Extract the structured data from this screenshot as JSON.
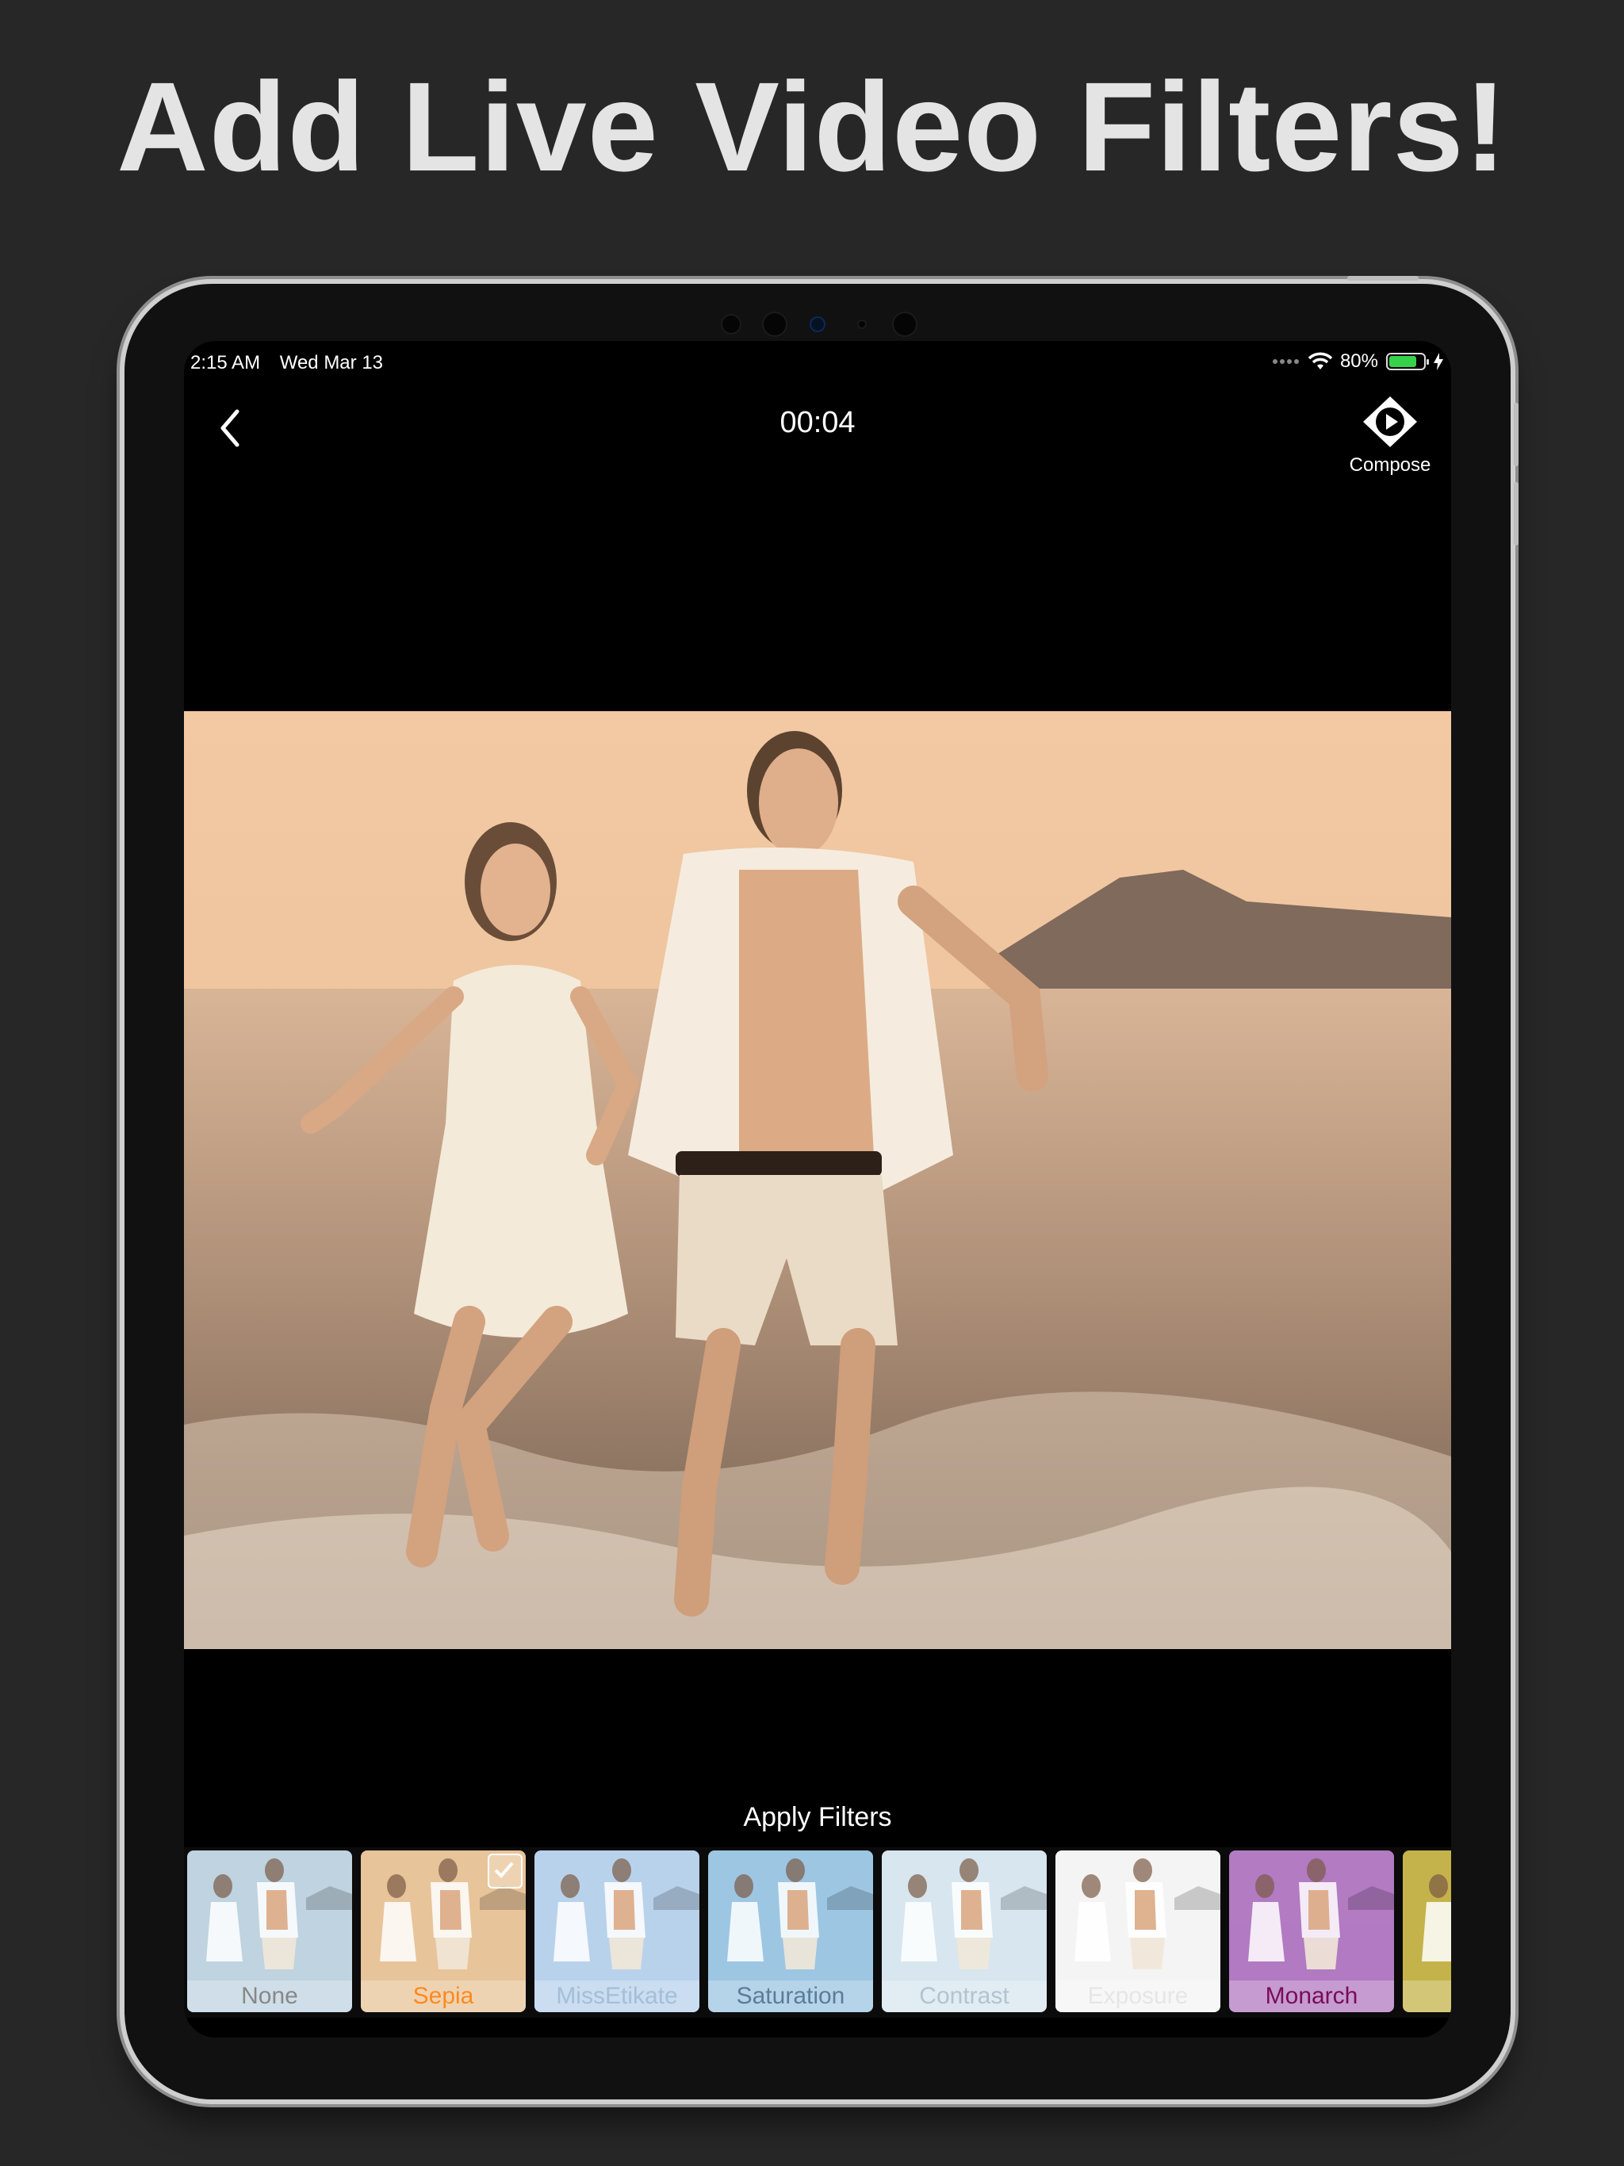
{
  "headline": "Add Live Video Filters!",
  "status_bar": {
    "time": "2:15 AM",
    "date": "Wed Mar 13",
    "battery": "80%",
    "battery_level": 0.8
  },
  "nav": {
    "timer": "00:04",
    "compose_label": "Compose"
  },
  "apply_filters_label": "Apply Filters",
  "filters": [
    {
      "name": "None",
      "tint": "#bfd3e0",
      "label_color": "#888888",
      "selected": false
    },
    {
      "name": "Sepia",
      "tint": "#e8c49a",
      "label_color": "#ff8a1c",
      "selected": true
    },
    {
      "name": "MissEtikate",
      "tint": "#b9d2ec",
      "label_color": "#a4bfd6",
      "selected": false
    },
    {
      "name": "Saturation",
      "tint": "#9dc6e3",
      "label_color": "#5b7d98",
      "selected": false
    },
    {
      "name": "Contrast",
      "tint": "#d7e6ef",
      "label_color": "#b2c4d0",
      "selected": false
    },
    {
      "name": "Exposure",
      "tint": "#f4f4f4",
      "label_color": "#e6e6e6",
      "selected": false
    },
    {
      "name": "Monarch",
      "tint": "#b27bc2",
      "label_color": "#7a0c57",
      "selected": false
    },
    {
      "name": "",
      "tint": "#c4b34a",
      "label_color": "#7a6a10",
      "selected": false
    }
  ],
  "colors": {
    "background": "#272727",
    "headline": "#e4e4e4",
    "sepia_highlight": "#ff8a1c"
  }
}
